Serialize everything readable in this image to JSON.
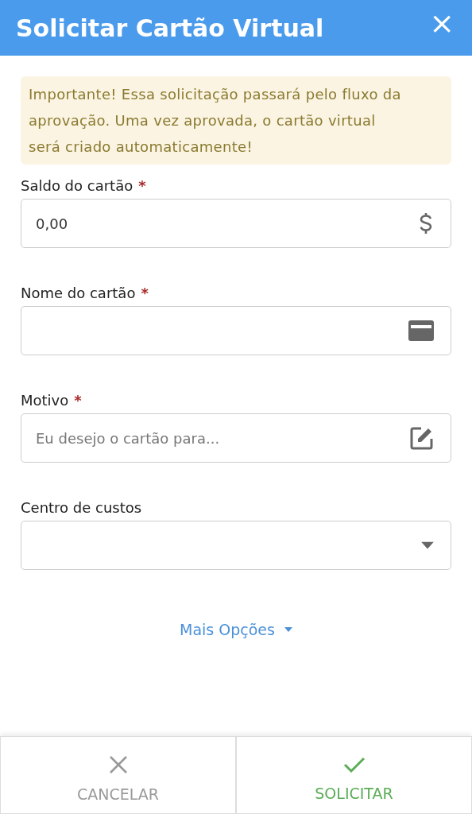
{
  "window": {
    "title": "Solicitar Cartão Virtual",
    "close": "×"
  },
  "notice": "Importante! Essa solicitação passará pelo fluxo da aprovação. Uma vez aprovada, o cartão virtual será criado automaticamente!",
  "fields": [
    {
      "label": "Saldo do cartão",
      "required_mark": "*",
      "value": "0,00",
      "kind": "currency"
    },
    {
      "label": "Nome do cartão",
      "required_mark": "*",
      "kind": "card"
    },
    {
      "label": "Motivo",
      "required_mark": "*",
      "placeholder": "Eu desejo o cartão para...",
      "kind": "edit"
    },
    {
      "label": "Centro de custos",
      "kind": "dropdown"
    }
  ],
  "more_options": "Mais Opções",
  "buttons": [
    {
      "label": "CANCELAR",
      "kind": "cancel"
    },
    {
      "label": "SOLICITAR",
      "kind": "confirm"
    }
  ]
}
